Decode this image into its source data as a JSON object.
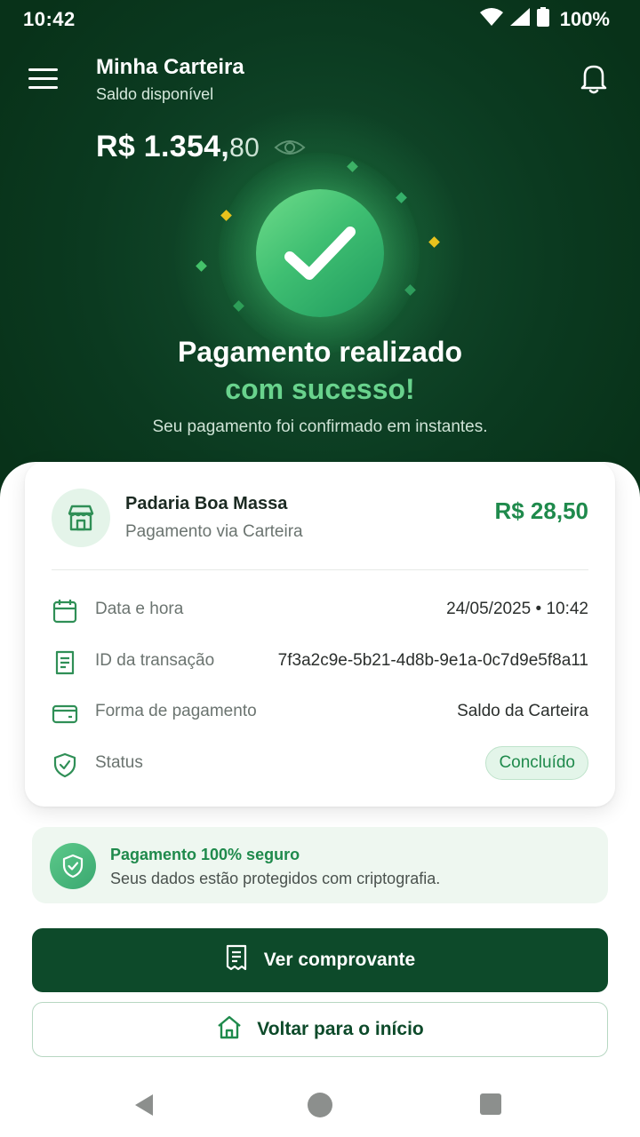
{
  "status_bar": {
    "time": "10:42",
    "battery": "100%"
  },
  "header": {
    "title": "Minha Carteira",
    "subtitle": "Saldo disponível"
  },
  "balance": {
    "whole": "R$ 1.354,",
    "cents": "80"
  },
  "success": {
    "line1": "Pagamento realizado",
    "line2": "com sucesso!",
    "subtitle": "Seu pagamento foi confirmado em instantes."
  },
  "transaction": {
    "merchant": "Padaria Boa Massa",
    "method_label": "Pagamento via Carteira",
    "amount": "R$ 28,50",
    "details": [
      {
        "label": "Data e hora",
        "value": "24/05/2025 • 10:42",
        "icon": "calendar-icon"
      },
      {
        "label": "ID da transação",
        "value": "7f3a2c9e-5b21-4d8b-9e1a-0c7d9e5f8a11",
        "icon": "receipt-icon"
      },
      {
        "label": "Forma de pagamento",
        "value": "Saldo da Carteira",
        "icon": "wallet-icon"
      },
      {
        "label": "Status",
        "value": "Concluído",
        "icon": "shield-check-icon"
      }
    ]
  },
  "security": {
    "title": "Pagamento 100% seguro",
    "text": "Seus dados estão protegidos com criptografia."
  },
  "actions": {
    "primary": "Ver comprovante",
    "secondary": "Voltar para o início"
  },
  "colors": {
    "hero_bg": "#0b3a20",
    "accent_green": "#1f8a4c",
    "success_text": "#69d38d",
    "primary_button": "#0d4a2a"
  }
}
